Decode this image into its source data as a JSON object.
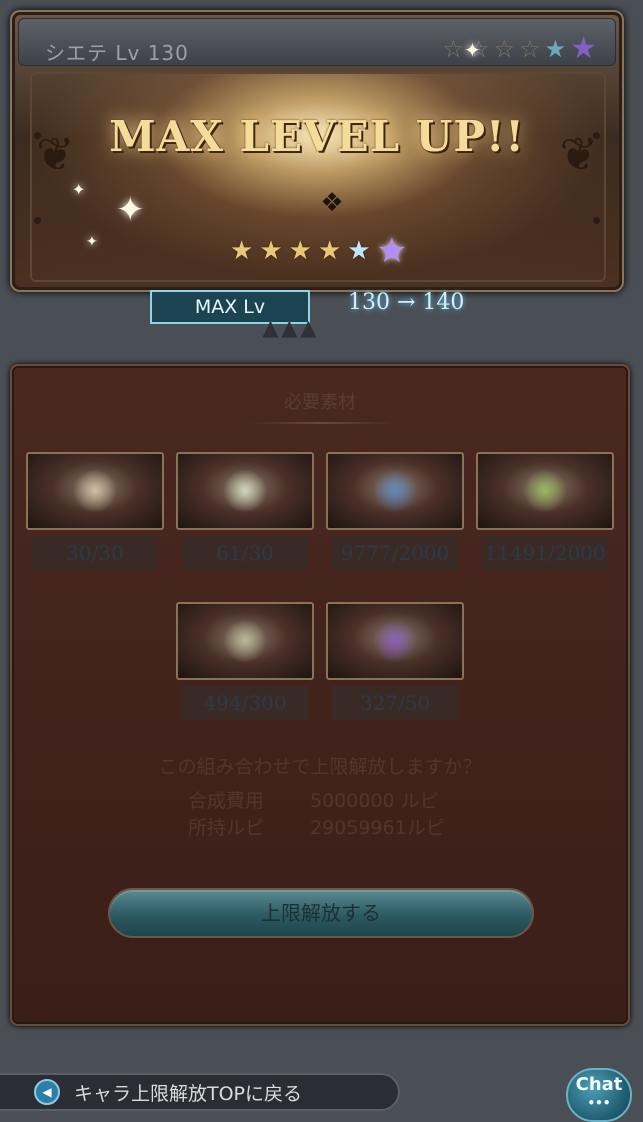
{
  "banner": {
    "character_name": "シエテ Lv 130",
    "title": "MAX LEVEL UP!!",
    "header_stars": 6,
    "rank_stars": 6
  },
  "level": {
    "box_label": "MAX Lv",
    "change": "130 → 140"
  },
  "panel": {
    "title": "必要素材",
    "materials": [
      {
        "count": "30/30",
        "glow": "#e6d2b4"
      },
      {
        "count": "61/30",
        "glow": "#e6f0d2"
      },
      {
        "count": "9777/2000",
        "glow": "#5a8cd2"
      },
      {
        "count": "11491/2000",
        "glow": "#a0c864"
      },
      {
        "count": "494/300",
        "glow": "#c8c8aa"
      },
      {
        "count": "327/50",
        "glow": "#8c5ac8"
      }
    ],
    "question": "この組み合わせで上限解放しますか？",
    "cost_label": "合成費用",
    "cost_value": "5000000 ルピ",
    "owned_label": "所持ルピ",
    "owned_value": "29059961ルピ",
    "button_label": "上限解放する"
  },
  "footer": {
    "back_label": "キャラ上限解放TOPに戻る",
    "chat_label": "Chat"
  }
}
